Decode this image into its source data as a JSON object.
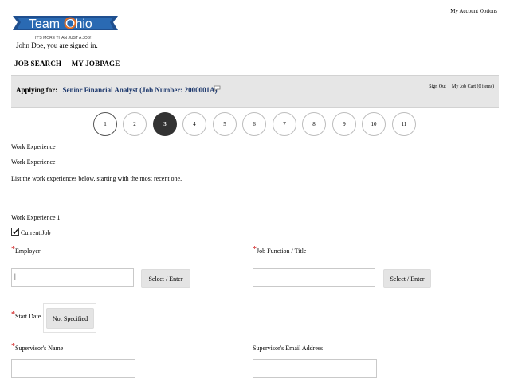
{
  "header": {
    "logo_text_team": "Team",
    "logo_text_ohio": "Ohio",
    "logo_tagline": "IT'S MORE THAN JUST A JOB!",
    "account_options": "My Account Options",
    "signed_in": "John Doe, you are signed in."
  },
  "nav": {
    "job_search": "JOB SEARCH",
    "my_jobpage": "MY JOBPAGE"
  },
  "apply_bar": {
    "label": "Applying for:",
    "job": "Senior Financial Analyst (Job Number: 2000001A)",
    "sign_out": "Sign Out",
    "sep": "|",
    "job_cart": "My Job Cart (0 items)"
  },
  "steps": [
    "1",
    "2",
    "3",
    "4",
    "5",
    "6",
    "7",
    "8",
    "9",
    "10",
    "11"
  ],
  "active_step": "3",
  "section": {
    "title1": "Work Experience",
    "title2": "Work Experience",
    "instructions": "List the work experiences below, starting with the most recent one.",
    "entry_title": "Work Experience 1",
    "current_job_label": "Current Job",
    "current_job_checked": true
  },
  "fields": {
    "required_mark": "*",
    "employer_label": "Employer",
    "employer_value": "|",
    "employer_button": "Select / Enter",
    "job_function_label": "Job Function / Title",
    "job_function_button": "Select / Enter",
    "start_date_label": "Start Date",
    "start_date_value": "Not Specified",
    "supervisor_name_label": "Supervisor's Name",
    "supervisor_email_label": "Supervisor's Email Address"
  },
  "colors": {
    "brand_blue": "#1f4f8f",
    "brand_orange": "#e66a1e",
    "bar_bg": "#e6e6e6",
    "required_red": "#cc0000"
  }
}
